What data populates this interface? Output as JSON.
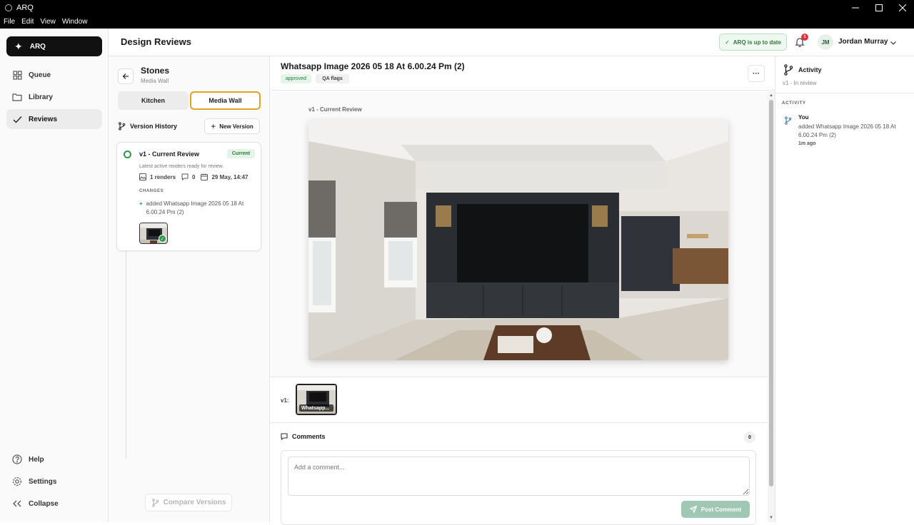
{
  "window": {
    "title": "ARQ",
    "menu": [
      "File",
      "Edit",
      "View",
      "Window"
    ]
  },
  "sidebar": {
    "brand": "ARQ",
    "items": [
      {
        "label": "Queue",
        "icon": "grid-icon"
      },
      {
        "label": "Library",
        "icon": "folder-icon"
      },
      {
        "label": "Reviews",
        "icon": "check-icon",
        "active": true
      }
    ],
    "bottom": [
      {
        "label": "Help",
        "icon": "help-icon"
      },
      {
        "label": "Settings",
        "icon": "gear-icon"
      },
      {
        "label": "Collapse",
        "icon": "double-chevron-left-icon"
      }
    ]
  },
  "header": {
    "title": "Design Reviews",
    "status": "ARQ is up to date",
    "notifications": "1",
    "user_initials": "JM",
    "user_name": "Jordan Murray"
  },
  "project": {
    "title": "Stones",
    "subtitle": "Media Wall",
    "tabs": [
      {
        "label": "Kitchen"
      },
      {
        "label": "Media Wall",
        "selected": true
      }
    ],
    "version_history_label": "Version History",
    "new_version_label": "New Version",
    "compare_label": "Compare Versions"
  },
  "version": {
    "title": "v1 - Current Review",
    "badge": "Current",
    "description": "Latest active renders ready for review.",
    "renders": "1 renders",
    "comments": "0",
    "date": "29 May, 14:47",
    "changes_heading": "CHANGES",
    "change": "added Whatsapp Image 2026 05 18 At 6.00.24 Pm (2)"
  },
  "asset": {
    "title": "Whatsapp Image 2026 05 18 At 6.00.24 Pm (2)",
    "status_pill": "approved",
    "qa_pill": "QA flags",
    "more": "···",
    "viewer_label": "v1 - Current Review",
    "strip_label": "v1:",
    "thumb_label": "Whatsapp..."
  },
  "comments": {
    "heading": "Comments",
    "count": "0",
    "placeholder": "Add a comment...",
    "post_label": "Post Comment"
  },
  "activity": {
    "title": "Activity",
    "subtitle": "v1 - In review",
    "heading": "ACTIVITY",
    "who": "You",
    "text": "added Whatsapp Image 2026 05 18 At 6.00.24 Pm (2)",
    "time": "1m ago"
  },
  "colors": {
    "accent": "#e0a421",
    "success": "#2c9a48",
    "brand_bg": "#111111"
  }
}
